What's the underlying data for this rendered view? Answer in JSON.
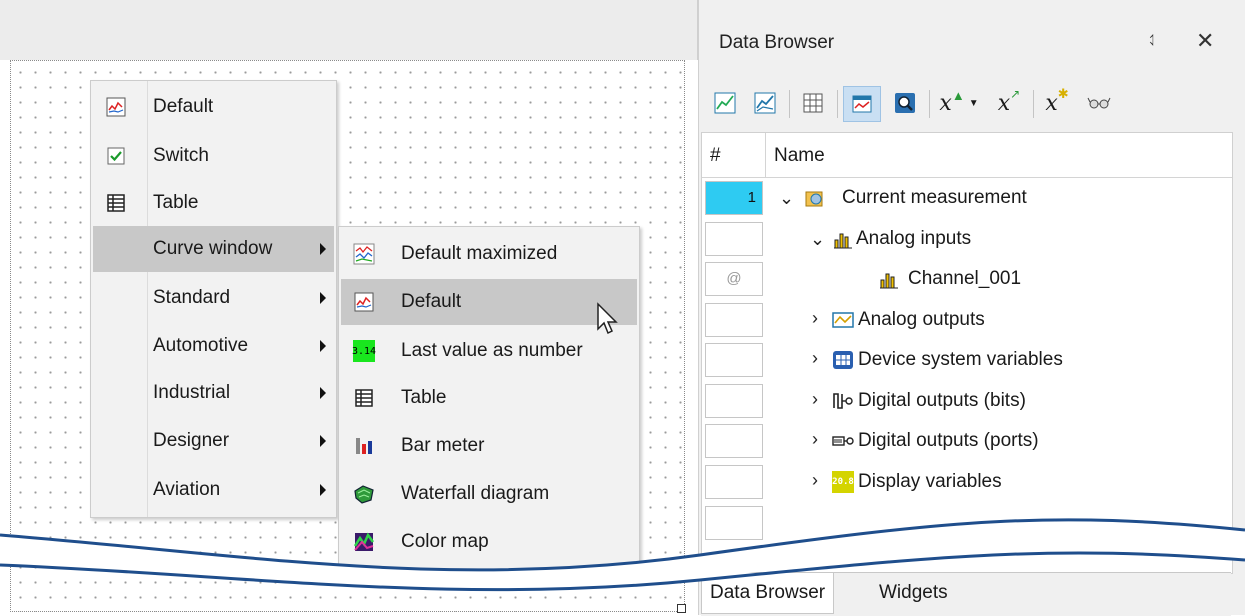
{
  "context_menu": {
    "items": [
      {
        "label": "Default",
        "icon": "curve-window-icon",
        "submenu": false
      },
      {
        "label": "Switch",
        "icon": "checkbox-icon",
        "submenu": false
      },
      {
        "label": "Table",
        "icon": "table-icon",
        "submenu": false
      },
      {
        "label": "Curve window",
        "icon": "",
        "submenu": true
      },
      {
        "label": "Standard",
        "icon": "",
        "submenu": true
      },
      {
        "label": "Automotive",
        "icon": "",
        "submenu": true
      },
      {
        "label": "Industrial",
        "icon": "",
        "submenu": true
      },
      {
        "label": "Designer",
        "icon": "",
        "submenu": true
      },
      {
        "label": "Aviation",
        "icon": "",
        "submenu": true
      }
    ],
    "highlighted": "Curve window"
  },
  "submenu": {
    "items": [
      {
        "label": "Default maximized",
        "icon": "curve-window-maximized-icon"
      },
      {
        "label": "Default",
        "icon": "curve-window-icon"
      },
      {
        "label": "Last value as number",
        "icon": "number-display-icon",
        "icon_text": "3.14"
      },
      {
        "label": "Table",
        "icon": "table-icon"
      },
      {
        "label": "Bar meter",
        "icon": "bar-meter-icon"
      },
      {
        "label": "Waterfall diagram",
        "icon": "waterfall-icon"
      },
      {
        "label": "Color map",
        "icon": "color-map-icon"
      }
    ],
    "highlighted": "Default"
  },
  "panel": {
    "title": "Data Browser",
    "pin_glyph": "⥑",
    "close_glyph": "✕",
    "toolbar": [
      "curve-icon",
      "curve-alt-icon",
      "grid-icon",
      "display-icon",
      "zoom-icon",
      "formula-dropdown-icon",
      "formula-icon",
      "formula-new-icon",
      "glasses-icon"
    ],
    "columns": {
      "index": "#",
      "name": "Name"
    },
    "rows": [
      {
        "index": "1",
        "label": "Current measurement",
        "expanded": true,
        "level": 0,
        "icon": "measurement-icon"
      },
      {
        "index": "",
        "label": "Analog inputs",
        "expanded": true,
        "level": 1,
        "icon": "analog-inputs-icon"
      },
      {
        "index": "@",
        "label": "Channel_001",
        "expanded": null,
        "level": 2,
        "icon": "channel-icon"
      },
      {
        "index": "",
        "label": "Analog outputs",
        "expanded": false,
        "level": 1,
        "icon": "analog-outputs-icon"
      },
      {
        "index": "",
        "label": "Device system variables",
        "expanded": false,
        "level": 1,
        "icon": "device-vars-icon"
      },
      {
        "index": "",
        "label": "Digital outputs (bits)",
        "expanded": false,
        "level": 1,
        "icon": "digital-bits-icon"
      },
      {
        "index": "",
        "label": "Digital outputs (ports)",
        "expanded": false,
        "level": 1,
        "icon": "digital-ports-icon"
      },
      {
        "index": "",
        "label": "Display variables",
        "expanded": false,
        "level": 1,
        "icon": "display-vars-icon",
        "icon_text": "20.8"
      }
    ],
    "tabs": [
      "Data Browser",
      "Widgets"
    ]
  },
  "colors": {
    "selection": "#2ecbf2",
    "menu_highlight": "#c8c8c8",
    "toolbar_active": "#c9dff3",
    "wave": "#1f4e8c"
  }
}
